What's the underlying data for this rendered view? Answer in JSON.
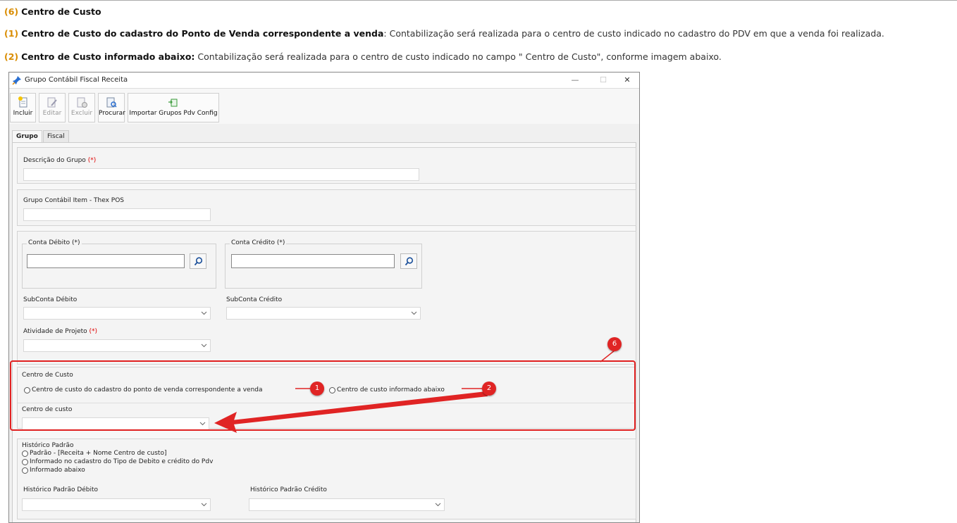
{
  "doc": {
    "heading_num": "(6)",
    "heading_text": "Centro de Custo",
    "item1_num": "(1)",
    "item1_bold": "Centro de Custo do cadastro do Ponto de Venda correspondente a venda",
    "item1_rest": ": Contabilização será realizada para o centro de custo indicado no cadastro do PDV em que a venda foi realizada.",
    "item2_num": "(2)",
    "item2_bold": "Centro de Custo informado abaixo:",
    "item2_rest": " Contabilização será realizada para o centro de custo indicado no campo \" Centro de Custo\", conforme imagem abaixo."
  },
  "window": {
    "title": "Grupo Contábil Fiscal Receita",
    "minimize": "—",
    "maximize": "☐",
    "close": "✕"
  },
  "toolbar": {
    "incluir": "Incluir",
    "editar": "Editar",
    "excluir": "Excluir",
    "procurar": "Procurar",
    "importar": "Importar Grupos Pdv Config"
  },
  "tabs": [
    "Grupo",
    "Fiscal"
  ],
  "form": {
    "descricao_label": "Descrição do Grupo",
    "required_mark": "(*)",
    "grupo_item_label": "Grupo Contábil Item - Thex POS",
    "conta_debito_label": "Conta Débito (*)",
    "conta_credito_label": "Conta Crédito (*)",
    "subconta_debito_label": "SubConta Débito",
    "subconta_credito_label": "SubConta Crédito",
    "atividade_label": "Atividade de Projeto",
    "centro_custo_group": "Centro de Custo",
    "radio_pdv": "Centro de custo do cadastro do ponto de venda correspondente a venda",
    "radio_informado": "Centro de custo informado abaixo",
    "centro_custo_label": "Centro de custo",
    "historico_group": "Histórico Padrão",
    "hist_opt1": "Padrão - [Receita + Nome Centro de custo]",
    "hist_opt2": "Informado no cadastro do Tipo de Debito e crédito do Pdv",
    "hist_opt3": "Informado abaixo",
    "hist_debito_label": "Histórico Padrão Débito",
    "hist_credito_label": "Histórico Padrão Crédito"
  },
  "annotations": {
    "badge6": "6",
    "badge1": "1",
    "badge2": "2",
    "color": "#e02424"
  }
}
